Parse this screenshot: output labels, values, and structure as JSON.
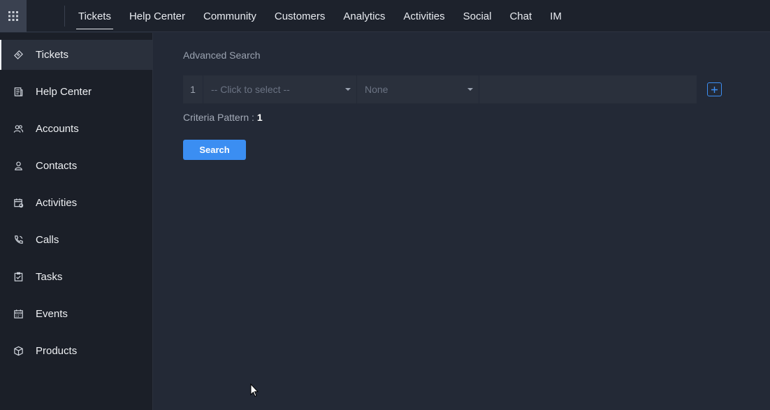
{
  "topnav": {
    "items": [
      {
        "label": "Tickets",
        "active": true
      },
      {
        "label": "Help Center"
      },
      {
        "label": "Community"
      },
      {
        "label": "Customers"
      },
      {
        "label": "Analytics"
      },
      {
        "label": "Activities"
      },
      {
        "label": "Social"
      },
      {
        "label": "Chat"
      },
      {
        "label": "IM"
      }
    ]
  },
  "sidebar": {
    "items": [
      {
        "label": "Tickets",
        "icon": "ticket-icon",
        "active": true
      },
      {
        "label": "Help Center",
        "icon": "article-icon"
      },
      {
        "label": "Accounts",
        "icon": "accounts-icon"
      },
      {
        "label": "Contacts",
        "icon": "contact-icon"
      },
      {
        "label": "Activities",
        "icon": "activities-icon"
      },
      {
        "label": "Calls",
        "icon": "phone-icon"
      },
      {
        "label": "Tasks",
        "icon": "task-icon"
      },
      {
        "label": "Events",
        "icon": "calendar-icon"
      },
      {
        "label": "Products",
        "icon": "box-icon"
      }
    ]
  },
  "main": {
    "title": "Advanced Search",
    "criteria": {
      "row_number": "1",
      "field_placeholder": "-- Click to select --",
      "operator_value": "None",
      "value": ""
    },
    "pattern_label": "Criteria Pattern :",
    "pattern_value": "1",
    "search_label": "Search"
  },
  "colors": {
    "accent": "#3b8ef2",
    "background": "#232936",
    "sidebar": "#1b1f28",
    "topbar": "#1d222c"
  }
}
